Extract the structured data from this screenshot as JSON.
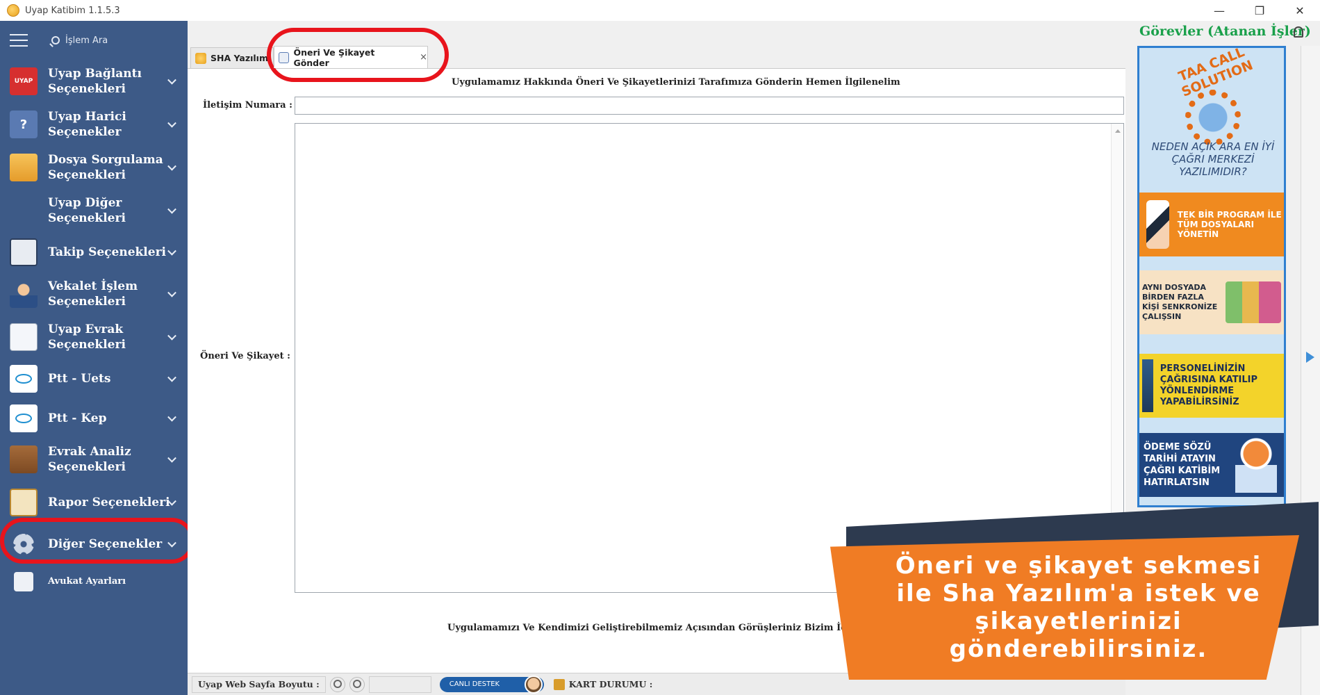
{
  "window": {
    "title": "Uyap Katibim 1.1.5.3",
    "controls": [
      "—",
      "❐",
      "✕"
    ]
  },
  "sidebar": {
    "search_placeholder": "İşlem Ara",
    "items": [
      {
        "label": "Uyap Bağlantı Seçenekleri",
        "icon": "uyap-icon",
        "icon_text": "UYAP"
      },
      {
        "label": "Uyap Harici Seçenekler",
        "icon": "help-icon",
        "icon_text": "?"
      },
      {
        "label": "Dosya Sorgulama Seçenekleri",
        "icon": "folder-icon"
      },
      {
        "label": "Uyap Diğer Seçenekleri",
        "icon": "grid-icon"
      },
      {
        "label": "Takip Seçenekleri",
        "icon": "tracking-icon"
      },
      {
        "label": "Vekalet İşlem Seçenekleri",
        "icon": "agent-icon"
      },
      {
        "label": "Uyap Evrak Seçenekleri",
        "icon": "document-icon"
      },
      {
        "label": "Ptt - Uets",
        "icon": "ptt-icon"
      },
      {
        "label": "Ptt - Kep",
        "icon": "ptt-icon"
      },
      {
        "label": "Evrak Analiz Seçenekleri",
        "icon": "briefcase-icon"
      },
      {
        "label": "Rapor Seçenekleri",
        "icon": "clipboard-icon"
      },
      {
        "label": "Diğer Seçenekler",
        "icon": "gear-icon"
      },
      {
        "label": "Avukat Ayarları",
        "icon": "lawyer-icon"
      }
    ]
  },
  "tabs": [
    {
      "label": "SHA Yazılım",
      "active": false
    },
    {
      "label": "Öneri Ve Şikayet Gönder",
      "active": true,
      "close": "×"
    }
  ],
  "form": {
    "heading": "Uygulamamız Hakkında Öneri Ve Şikayetlerinizi Tarafımıza Gönderin Hemen İlgilenelim",
    "phone_label": "İletişim Numara :",
    "phone_value": "",
    "complaint_label": "Öneri Ve Şikayet :",
    "complaint_value": "",
    "footer": "Uygulamamızı Ve Kendimizi Geliştirebilmemiz Açısından Görüşleriniz Bizim İçin Ön"
  },
  "statusbar": {
    "web_size_label": "Uyap Web Sayfa Boyutu :",
    "live_support": "CANLI DESTEK",
    "card_status": "KART DURUMU :"
  },
  "right_panel": {
    "title": "Görevler (Atanan İşler)",
    "ad": {
      "brand": "TAA CALL SOLUTION",
      "question": "NEDEN AÇIK ARA EN İYİ ÇAĞRI MERKEZİ YAZILIMIDIR?",
      "blocks": [
        "TEK BİR PROGRAM İLE TÜM DOSYALARI YÖNETİN",
        "AYNI DOSYADA BİRDEN FAZLA KİŞİ SENKRONİZE ÇALIŞSIN",
        "PERSONELİNİZİN ÇAĞRISINA KATILIP YÖNLENDİRME YAPABİLİRSİNİZ",
        "ÖDEME SÖZÜ TARİHİ ATAYIN ÇAĞRI KATİBİM HATIRLATSIN"
      ]
    }
  },
  "callout": {
    "text": "Öneri ve şikayet sekmesi ile Sha Yazılım'a istek ve şikayetlerinizi gönderebilirsiniz."
  },
  "colors": {
    "sidebar_bg": "#3d5a87",
    "highlight": "#e8141c",
    "callout_orange": "#f07c24",
    "tasks_green": "#19a04a"
  }
}
